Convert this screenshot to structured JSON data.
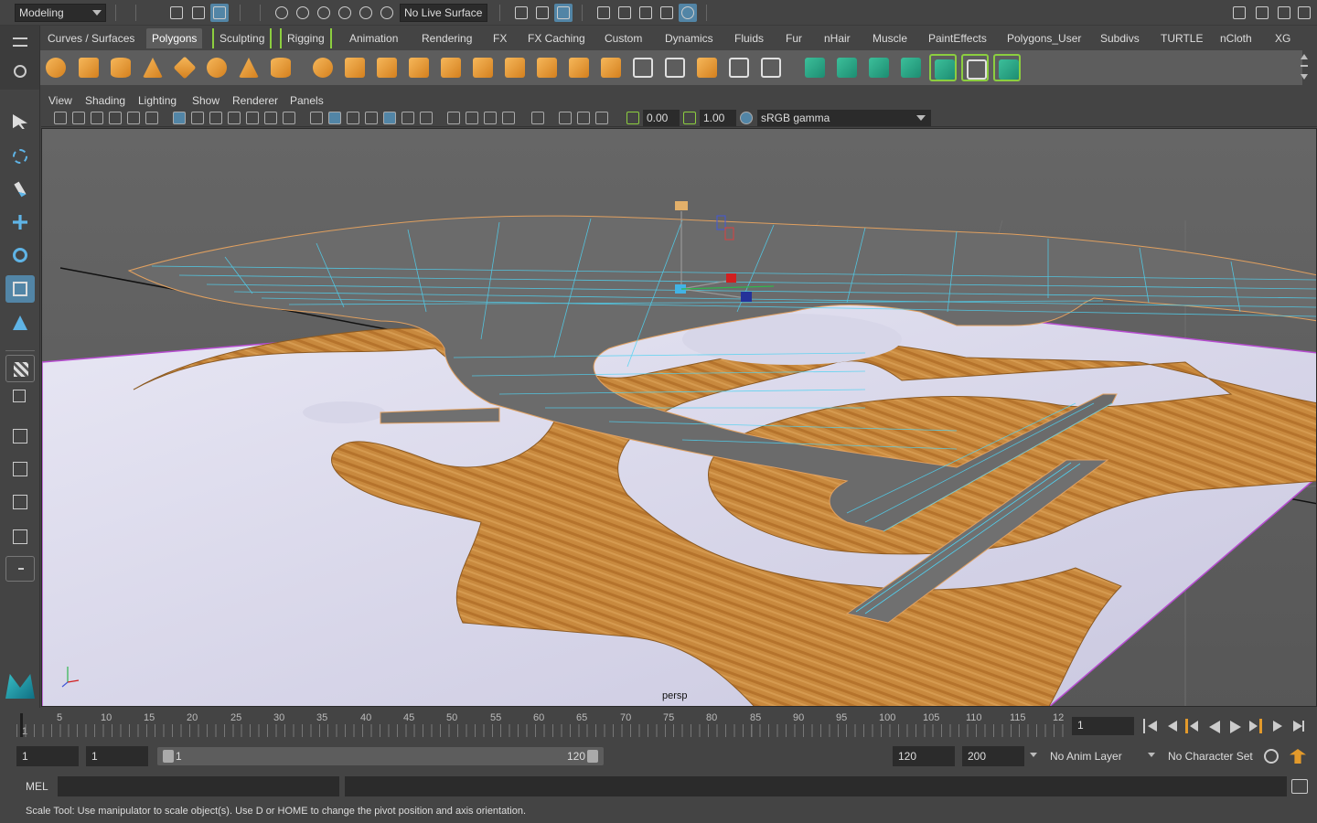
{
  "statusline": {
    "menuset": "Modeling",
    "live_surface": "No Live Surface"
  },
  "shelf": {
    "tabs": [
      "Curves / Surfaces",
      "Polygons",
      "Sculpting",
      "Rigging",
      "Animation",
      "Rendering",
      "FX",
      "FX Caching",
      "Custom",
      "Dynamics",
      "Fluids",
      "Fur",
      "nHair",
      "Muscle",
      "PaintEffects",
      "Polygons_User",
      "Subdivs",
      "TURTLE",
      "nCloth",
      "XG"
    ],
    "active_tab": "Polygons",
    "icons": [
      "poly-sphere-icon",
      "poly-cube-icon",
      "poly-cylinder-icon",
      "poly-cone-icon",
      "poly-plane-icon",
      "poly-torus-icon",
      "poly-pyramid-icon",
      "poly-pipe-icon"
    ]
  },
  "panel": {
    "menu": [
      "View",
      "Shading",
      "Lighting",
      "Show",
      "Renderer",
      "Panels"
    ],
    "exposure": "0.00",
    "gamma": "1.00",
    "color_space": "sRGB gamma",
    "camera": "persp"
  },
  "timeslider": {
    "ticks": [
      "1",
      "5",
      "10",
      "15",
      "20",
      "25",
      "30",
      "35",
      "40",
      "45",
      "50",
      "55",
      "60",
      "65",
      "70",
      "75",
      "80",
      "85",
      "90",
      "95",
      "100",
      "105",
      "110",
      "115",
      "12"
    ],
    "current_frame": "1"
  },
  "rangeslider": {
    "start": "1",
    "playback_start": "1",
    "range_start_label": "1",
    "range_end_label": "120",
    "playback_end": "120",
    "end": "200",
    "anim_layer": "No Anim Layer",
    "character_set": "No Character Set"
  },
  "cmdline": {
    "mel_label": "MEL"
  },
  "helpline": {
    "text": "Scale Tool: Use manipulator to scale object(s). Use D or HOME to change the pivot position and axis orientation."
  },
  "colors": {
    "accent": "#5285a6",
    "bracket": "#8cce3f",
    "wire": "#4fd3f2"
  }
}
